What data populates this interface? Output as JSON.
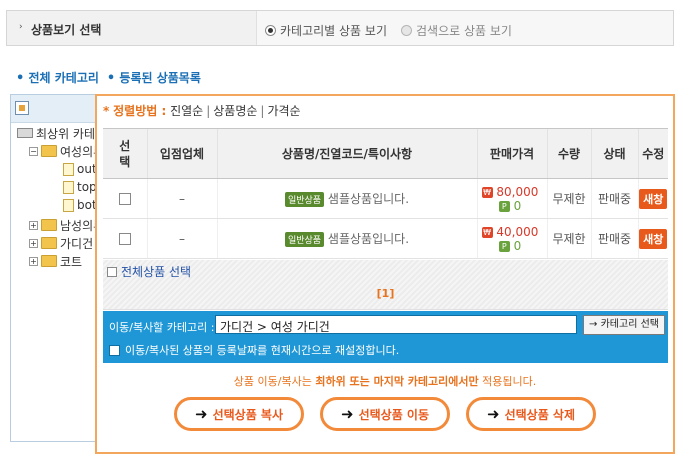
{
  "mode_bar": {
    "title": "상품보기 선택",
    "options": [
      {
        "label": "카테고리별 상품 보기",
        "selected": true
      },
      {
        "label": "검색으로 상품 보기",
        "selected": false
      }
    ]
  },
  "links": {
    "all_category": "전체 카테고리",
    "registered_list": "등록된 상품목록"
  },
  "tree": {
    "items": [
      {
        "label": "최상위 카테고리",
        "icon": "drive-icon",
        "toggle": ""
      },
      {
        "label": "여성의류",
        "icon": "folder-icon",
        "toggle": "−"
      },
      {
        "label": "outer",
        "icon": "doc-icon",
        "toggle": ""
      },
      {
        "label": "top",
        "icon": "doc-icon",
        "toggle": ""
      },
      {
        "label": "bottom",
        "icon": "doc-icon",
        "toggle": ""
      },
      {
        "label": "남성의류",
        "icon": "folder-icon",
        "toggle": "+"
      },
      {
        "label": "가디건",
        "icon": "folder-icon",
        "toggle": "+"
      },
      {
        "label": "코트",
        "icon": "folder-icon",
        "toggle": "+"
      }
    ]
  },
  "sort": {
    "label": "정렬방법 :",
    "options": [
      "진열순",
      "상품명순",
      "가격순"
    ]
  },
  "table": {
    "headers": [
      "선택",
      "입점업체",
      "상품명/진열코드/특이사항",
      "판매가격",
      "수량",
      "상태",
      "수정"
    ],
    "rows": [
      {
        "vendor": "–",
        "badge": "일반상품",
        "name": "샘플상품입니다.",
        "price": "80,000",
        "point": "0",
        "quantity": "무제한",
        "status": "판매중",
        "edit": "새창"
      },
      {
        "vendor": "–",
        "badge": "일반상품",
        "name": "샘플상품입니다.",
        "price": "40,000",
        "point": "0",
        "quantity": "무제한",
        "status": "판매중",
        "edit": "새창"
      }
    ]
  },
  "select_all": "전체상품 선택",
  "pager": "[1]",
  "move": {
    "label": "이동/복사할 카테고리 :",
    "category": "가디건 > 여성 가디건",
    "category_button": "→ 카테고리 선택",
    "reset_label": "이동/복사된 상품의 등록날짜를 현재시간으로 재설정합니다."
  },
  "notice": {
    "prefix": "상품 이동/복사는 ",
    "emph": "최하위 또는 마지막 카테고리에서만",
    "suffix": " 적용됩니다."
  },
  "buttons": {
    "copy": "선택상품 복사",
    "move": "선택상품 이동",
    "delete": "선택상품 삭제"
  },
  "colors": {
    "accent": "#e8731e",
    "panel_border": "#f3a75c",
    "move_bar": "#1f97d6",
    "link": "#1a6fb5"
  }
}
